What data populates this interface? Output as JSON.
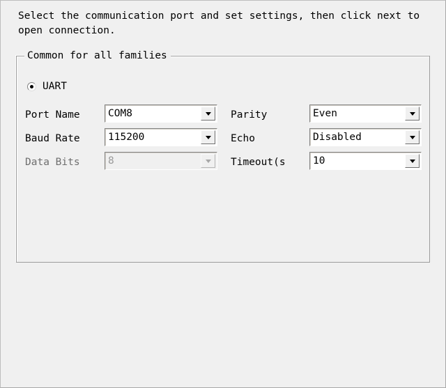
{
  "window": {
    "background_color": "#f0f0f0",
    "border_color": "#a8a8a8"
  },
  "instructions": {
    "text": "Select the communication port and set settings, then click next to open connection."
  },
  "groupbox": {
    "title": "Common for all families"
  },
  "connection_type": {
    "label": "UART",
    "selected": true
  },
  "fields": {
    "left": [
      {
        "label": "Port Name",
        "value": "COM8",
        "disabled": false,
        "name": "port-name"
      },
      {
        "label": "Baud Rate",
        "value": "115200",
        "disabled": false,
        "name": "baud-rate"
      },
      {
        "label": "Data Bits",
        "value": "8",
        "disabled": true,
        "name": "data-bits"
      }
    ],
    "right": [
      {
        "label": "Parity",
        "value": "Even",
        "disabled": false,
        "name": "parity"
      },
      {
        "label": "Echo",
        "value": "Disabled",
        "disabled": false,
        "name": "echo"
      },
      {
        "label": "Timeout(s",
        "value": "10",
        "disabled": false,
        "name": "timeout"
      }
    ]
  },
  "icons": {
    "dropdown_arrow": "chevron-down-icon",
    "radio_selected": "radio-selected-icon"
  }
}
